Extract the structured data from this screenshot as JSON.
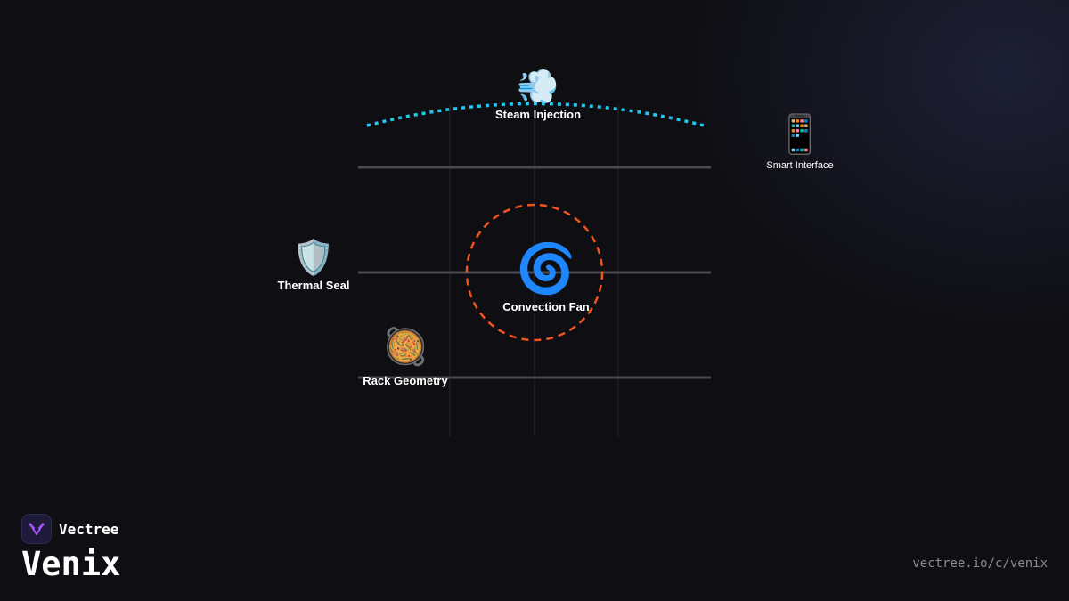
{
  "diagram": {
    "nodes": [
      {
        "id": "steam",
        "label": "Steam Injection",
        "icon": "steam-puff-icon",
        "glyph": "💨"
      },
      {
        "id": "smart",
        "label": "Smart Interface",
        "icon": "mobile-phone-icon",
        "glyph": "📱"
      },
      {
        "id": "seal",
        "label": "Thermal Seal",
        "icon": "shield-icon",
        "glyph": "🛡️"
      },
      {
        "id": "fan",
        "label": "Convection Fan",
        "icon": "cyclone-icon",
        "glyph": "🌀"
      },
      {
        "id": "rack",
        "label": "Rack Geometry",
        "icon": "pan-of-food-icon",
        "glyph": "🥘"
      }
    ],
    "colors": {
      "steam_arc": "#1ec8f0",
      "fan_ring": "#f0541e",
      "rack_line": "#4a4a4e",
      "grid_line": "#26262b"
    }
  },
  "footer": {
    "brand": "Vectree",
    "product": "Venix",
    "url": "vectree.io/c/venix",
    "logo_color": "#a855f7"
  }
}
